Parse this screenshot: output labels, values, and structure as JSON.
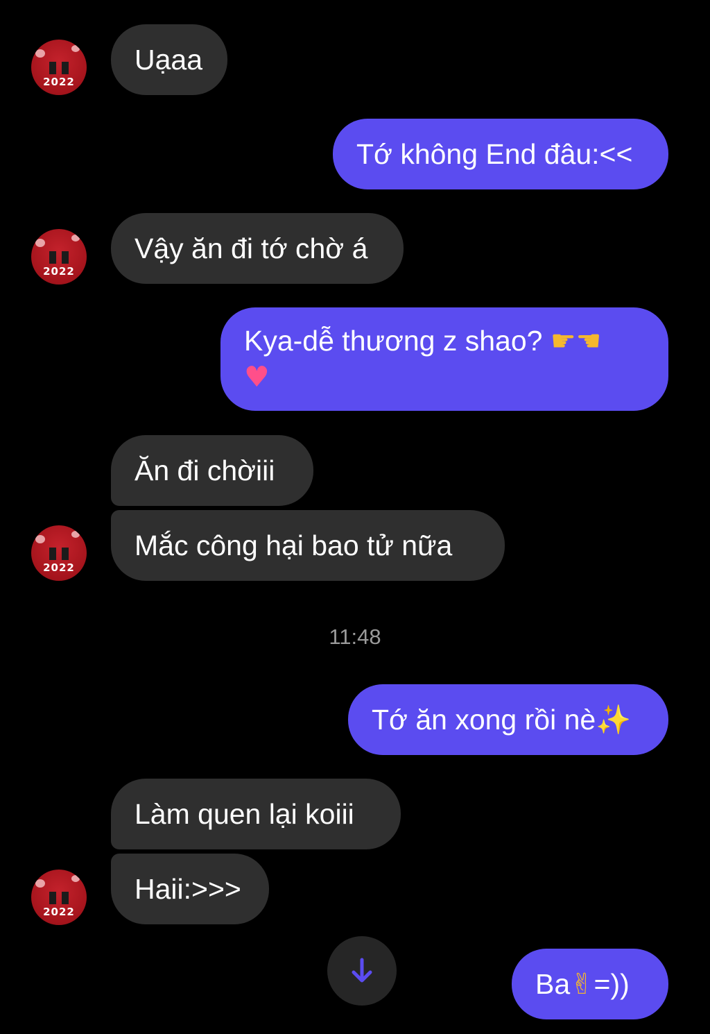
{
  "colors": {
    "background": "#000000",
    "incoming_bubble": "#2f2f2f",
    "outgoing_bubble": "#5b4cf0",
    "timestamp_text": "#9a9a9a"
  },
  "avatar": {
    "label": "2022"
  },
  "messages": [
    {
      "direction": "incoming",
      "text": "Uạaa"
    },
    {
      "direction": "outgoing",
      "text": "Tớ không End đâu:<<"
    },
    {
      "direction": "incoming",
      "text": "Vậy ăn đi tớ chờ á"
    },
    {
      "direction": "outgoing",
      "text": "Kya-dễ thương z shao?",
      "emoji": [
        "pointing-right-emoji",
        "pointing-left-emoji",
        "sparkling-heart-emoji"
      ]
    },
    {
      "direction": "incoming",
      "text": "Ăn đi chờiii"
    },
    {
      "direction": "incoming",
      "text": "Mắc công hại bao tử nữa"
    },
    {
      "direction": "outgoing",
      "text": "Tớ ăn xong rồi nè",
      "emoji": [
        "sparkles-emoji"
      ]
    },
    {
      "direction": "incoming",
      "text": "Làm quen lại koiii"
    },
    {
      "direction": "incoming",
      "text": "Haii:>>>"
    },
    {
      "direction": "outgoing",
      "text_before": "Ba",
      "text_after": "=))",
      "emoji": [
        "love-you-gesture-emoji"
      ]
    }
  ],
  "timestamp": "11:48",
  "scroll_button": {
    "icon": "arrow-down-icon"
  }
}
